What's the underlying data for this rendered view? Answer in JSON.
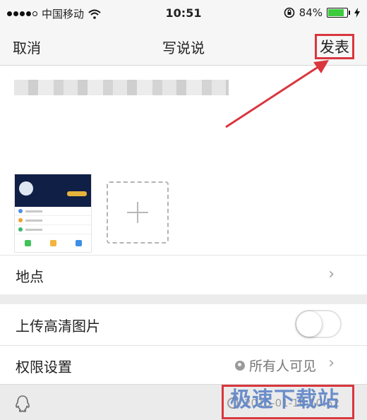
{
  "status_bar": {
    "carrier": "中国移动",
    "time": "10:51",
    "battery_percent": "84%",
    "battery_level": 0.84,
    "icons": [
      "signal-dots-icon",
      "wifi-icon",
      "rotation-lock-icon",
      "battery-icon",
      "charging-bolt-icon"
    ]
  },
  "nav": {
    "cancel_label": "取消",
    "title": "写说说",
    "publish_label": "发表"
  },
  "compose": {
    "text_blurred": true,
    "add_photo_icon": "plus-icon"
  },
  "rows": {
    "location_label": "地点",
    "hd_upload_label": "上传高清图片",
    "hd_upload_enabled": false,
    "permission_label": "权限设置",
    "permission_value": "所有人可见"
  },
  "bottom": {
    "qq_icon": "qq-penguin-icon",
    "timestamp": "2015-01-16 10:52",
    "watermark": "极速下载站"
  },
  "colors": {
    "annotation_red": "#d9363e",
    "toggle_off": "#ffffff",
    "watermark_blue": "#5a82c6"
  }
}
